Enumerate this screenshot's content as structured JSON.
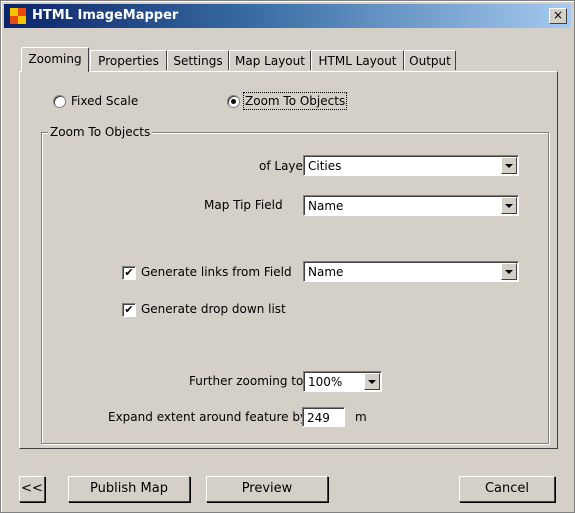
{
  "window": {
    "title": "HTML ImageMapper",
    "close_glyph": "×",
    "icon": "imagemapper-app-icon",
    "titlebar_color": "#0a246a"
  },
  "tabs": [
    {
      "label": "Zooming",
      "active": true
    },
    {
      "label": "Properties"
    },
    {
      "label": "Settings"
    },
    {
      "label": "Map Layout"
    },
    {
      "label": "HTML Layout"
    },
    {
      "label": "Output"
    }
  ],
  "mode": {
    "fixed_scale_label": "Fixed Scale",
    "zoom_to_objects_label": "Zoom To Objects",
    "selected": "zoom_to_objects"
  },
  "group": {
    "title": "Zoom To Objects",
    "layer_label": "of Layer",
    "layer_value": "Cities",
    "map_tip_label": "Map Tip Field",
    "map_tip_value": "Name",
    "generate_links_label": "Generate links from Field",
    "generate_links_checked": true,
    "generate_links_value": "Name",
    "drop_down_label": "Generate drop down list",
    "drop_down_checked": true,
    "further_zoom_label": "Further zooming to",
    "further_zoom_value": "100%",
    "expand_label": "Expand extent around feature by",
    "expand_value": "249",
    "expand_unit": "m"
  },
  "buttons": {
    "back": "<<",
    "publish": "Publish Map",
    "preview": "Preview",
    "cancel": "Cancel"
  },
  "check_glyph": "✔"
}
